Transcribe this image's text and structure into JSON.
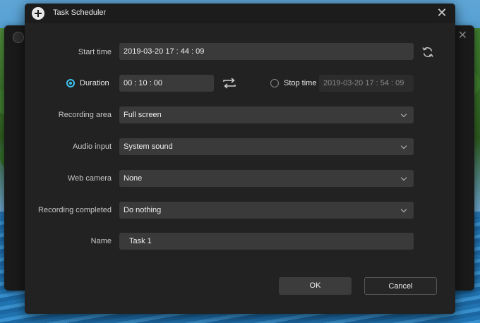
{
  "dialog": {
    "title": "Task Scheduler",
    "close_glyph": "✕"
  },
  "form": {
    "start_time_label": "Start time",
    "start_time_value": "2019-03-20 17 : 44 : 09",
    "duration_label": "Duration",
    "duration_value": "00 : 10 : 00",
    "duration_selected": true,
    "stop_time_label": "Stop time",
    "stop_time_value": "2019-03-20 17 : 54 : 09",
    "stop_time_selected": false,
    "recording_area_label": "Recording area",
    "recording_area_value": "Full screen",
    "audio_input_label": "Audio input",
    "audio_input_value": "System sound",
    "web_camera_label": "Web camera",
    "web_camera_value": "None",
    "recording_completed_label": "Recording completed",
    "recording_completed_value": "Do nothing",
    "name_label": "Name",
    "name_value": "Task 1"
  },
  "buttons": {
    "ok": "OK",
    "cancel": "Cancel"
  },
  "icons": {
    "title": "add-circle-icon",
    "refresh": "refresh-icon",
    "swap": "swap-icon",
    "dropdown": "chevron-down-icon"
  },
  "colors": {
    "accent": "#3ec3f0",
    "dialog_bg": "#222222",
    "field_bg": "#3a3a3a"
  }
}
